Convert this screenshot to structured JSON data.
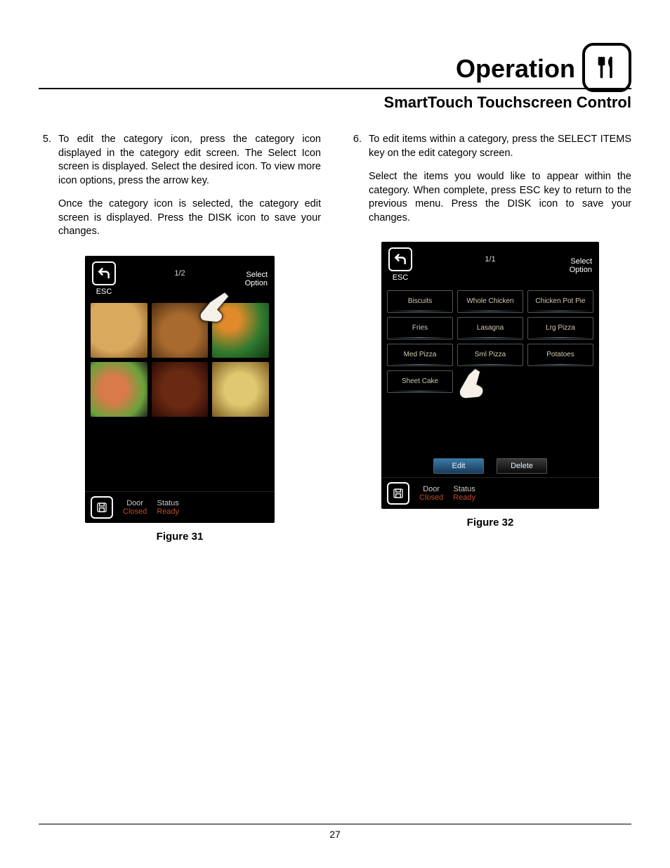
{
  "header": {
    "title": "Operation",
    "subtitle": "SmartTouch Touchscreen Control"
  },
  "page_number": "27",
  "left": {
    "step_num": "5.",
    "para1": "To edit the category icon, press the category icon displayed in the category edit screen. The Select Icon screen is displayed. Select the desired icon. To view more icon options, press the arrow key.",
    "para2": "Once the category icon is selected, the category edit screen is displayed. Press the DISK icon to save your changes.",
    "caption": "Figure 31"
  },
  "right": {
    "step_num": "6.",
    "para1": "To edit items within a category, press the SELECT ITEMS key on the edit category screen.",
    "para2": "Select the items you would like to appear within the category. When complete, press ESC key to return to the previous menu. Press the DISK icon to save your changes.",
    "caption": "Figure 32"
  },
  "fig31": {
    "esc": "ESC",
    "page_indicator": "1/2",
    "select_option_l1": "Select",
    "select_option_l2": "Option",
    "door_label": "Door",
    "door_value": "Closed",
    "status_label": "Status",
    "status_value": "Ready"
  },
  "fig32": {
    "esc": "ESC",
    "page_indicator": "1/1",
    "select_option_l1": "Select",
    "select_option_l2": "Option",
    "items": [
      "Biscuits",
      "Whole Chicken",
      "Chicken Pot Pie",
      "Fries",
      "Lasagna",
      "Lrg Pizza",
      "Med Pizza",
      "Sml Pizza",
      "Potatoes",
      "Sheet Cake"
    ],
    "edit": "Edit",
    "delete": "Delete",
    "door_label": "Door",
    "door_value": "Closed",
    "status_label": "Status",
    "status_value": "Ready"
  }
}
